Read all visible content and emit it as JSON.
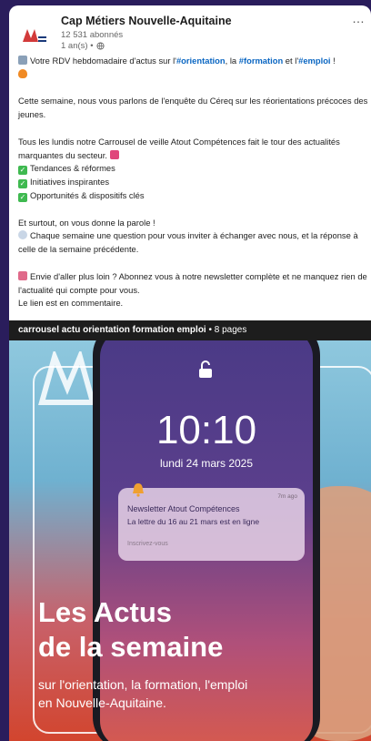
{
  "header": {
    "org_name": "Cap Métiers Nouvelle-Aquitaine",
    "followers": "12 531 abonnés",
    "time": "1 an(s) •",
    "more": "…"
  },
  "post": {
    "line1_pre": "Votre RDV hebdomadaire d'actus sur l'",
    "tag1": "#orientation",
    "line1_mid": ", la ",
    "tag2": "#formation",
    "line1_mid2": " et l'",
    "tag3": "#emploi",
    "line1_end": " !",
    "p2": "Cette semaine, nous vous parlons de l'enquête du Céreq sur les réorientations précoces des jeunes.",
    "p3": "Tous les lundis notre Carrousel de veille Atout Compétences fait le tour des actualités marquantes du secteur.",
    "bullets": [
      "Tendances & réformes",
      "Initiatives inspirantes",
      "Opportunités & dispositifs clés"
    ],
    "p4a": "Et surtout, on vous donne la parole !",
    "p4b": "Chaque semaine une question pour vous inviter à échanger avec nous, et la réponse à celle de la semaine précédente.",
    "p5a": "Envie d'aller plus loin ? Abonnez vous à notre newsletter complète et ne manquez rien de l'actualité qui compte pour vous.",
    "p5b": "Le lien est en commentaire."
  },
  "document": {
    "title": "carrousel actu orientation formation emploi",
    "pages": " • 8 pages"
  },
  "slide": {
    "clock": "10:10",
    "date": "lundi 24 mars 2025",
    "notif_ago": "7m ago",
    "notif_title": "Newsletter Atout Compétences",
    "notif_sub": "La lettre du 16 au 21 mars est en ligne",
    "notif_link": "Inscrivez-vous",
    "headline1": "Les Actus",
    "headline2": "de la semaine",
    "subline1": "sur l'orientation, la formation, l'emploi",
    "subline2": "en Nouvelle-Aquitaine."
  },
  "colors": {
    "tag": "#0a66c2",
    "page_bg": "#2a1d5c"
  }
}
